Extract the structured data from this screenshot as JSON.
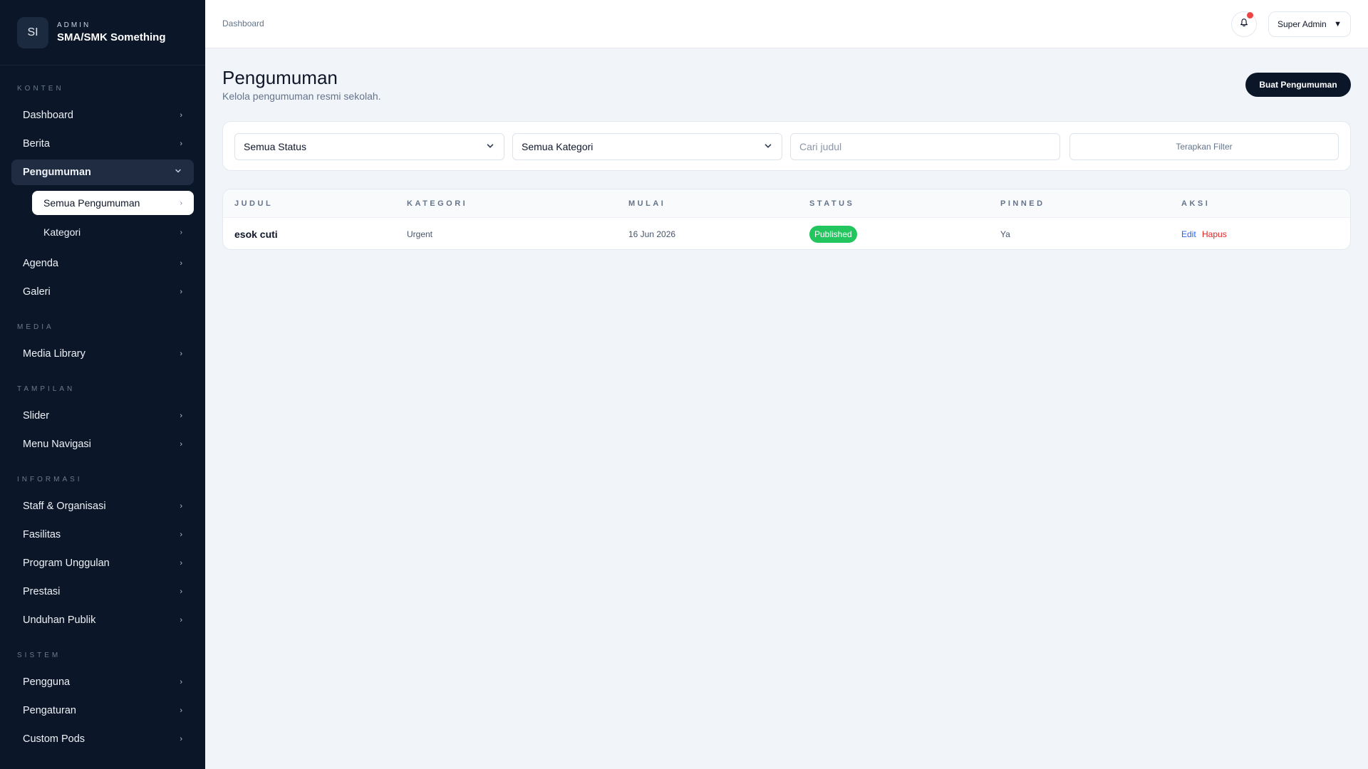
{
  "brand": {
    "logo": "SI",
    "eyebrow": "ADMIN",
    "name": "SMA/SMK Something"
  },
  "sidebar": {
    "sections": {
      "konten": "KONTEN",
      "media": "MEDIA",
      "tampilan": "TAMPILAN",
      "informasi": "INFORMASI",
      "sistem": "SISTEM"
    },
    "items": {
      "dashboard": "Dashboard",
      "berita": "Berita",
      "pengumuman": "Pengumuman",
      "semua_pengumuman": "Semua Pengumuman",
      "kategori": "Kategori",
      "agenda": "Agenda",
      "galeri": "Galeri",
      "media_library": "Media Library",
      "slider": "Slider",
      "menu_navigasi": "Menu Navigasi",
      "staff": "Staff & Organisasi",
      "fasilitas": "Fasilitas",
      "program": "Program Unggulan",
      "prestasi": "Prestasi",
      "unduhan": "Unduhan Publik",
      "pengguna": "Pengguna",
      "pengaturan": "Pengaturan",
      "custom_pods": "Custom Pods"
    }
  },
  "topbar": {
    "breadcrumb": "Dashboard",
    "user": "Super Admin"
  },
  "page": {
    "title": "Pengumuman",
    "subtitle": "Kelola pengumuman resmi sekolah.",
    "create_button": "Buat Pengumuman"
  },
  "filters": {
    "status": "Semua Status",
    "kategori": "Semua Kategori",
    "search_placeholder": "Cari judul",
    "apply": "Terapkan Filter"
  },
  "table": {
    "headers": {
      "judul": "JUDUL",
      "kategori": "KATEGORI",
      "mulai": "MULAI",
      "status": "STATUS",
      "pinned": "PINNED",
      "aksi": "AKSI"
    },
    "rows": [
      {
        "judul": "esok cuti",
        "kategori": "Urgent",
        "mulai": "16 Jun 2026",
        "status": "Published",
        "pinned": "Ya",
        "edit": "Edit",
        "hapus": "Hapus"
      }
    ]
  },
  "colors": {
    "sidebar_bg": "#0b1628",
    "published": "#22c55e",
    "edit": "#2563eb",
    "delete": "#dc2626",
    "notification": "#ef4444"
  }
}
